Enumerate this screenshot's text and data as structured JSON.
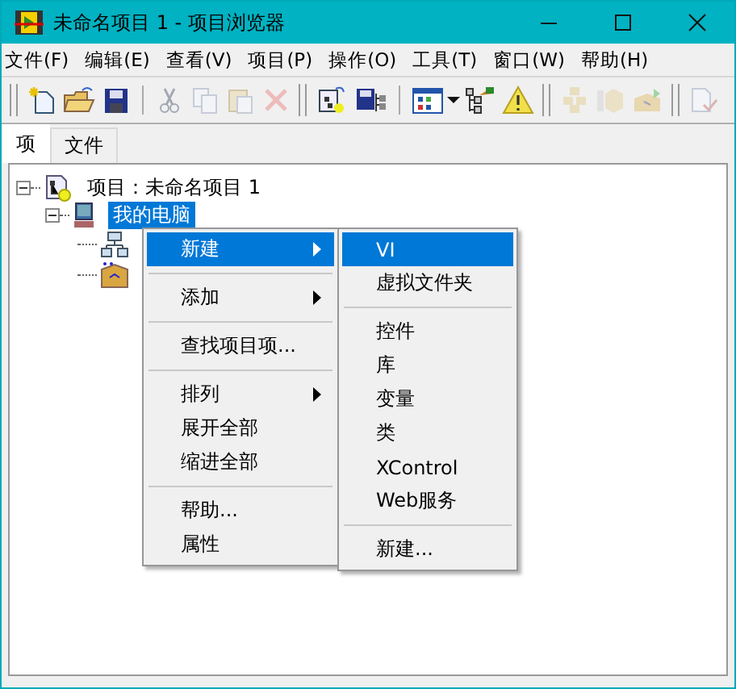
{
  "window": {
    "title": "未命名项目 1 - 项目浏览器"
  },
  "menu_bar": [
    "文件(F)",
    "编辑(E)",
    "查看(V)",
    "项目(P)",
    "操作(O)",
    "工具(T)",
    "窗口(W)",
    "帮助(H)"
  ],
  "toolbar": [
    {
      "kind": "grip"
    },
    {
      "kind": "new",
      "disabled": false
    },
    {
      "kind": "open",
      "disabled": false
    },
    {
      "kind": "save",
      "disabled": false
    },
    {
      "kind": "sep"
    },
    {
      "kind": "cut",
      "disabled": true
    },
    {
      "kind": "copy",
      "disabled": true
    },
    {
      "kind": "paste",
      "disabled": true
    },
    {
      "kind": "delete",
      "disabled": true
    },
    {
      "kind": "grip"
    },
    {
      "kind": "build",
      "disabled": false
    },
    {
      "kind": "saveall",
      "disabled": false
    },
    {
      "kind": "sep"
    },
    {
      "kind": "view",
      "disabled": false
    },
    {
      "kind": "dropdown",
      "disabled": false
    },
    {
      "kind": "tools",
      "disabled": false
    },
    {
      "kind": "warning",
      "disabled": false
    },
    {
      "kind": "grip"
    },
    {
      "kind": "cubes",
      "disabled": true
    },
    {
      "kind": "cube",
      "disabled": true
    },
    {
      "kind": "package",
      "disabled": true
    },
    {
      "kind": "grip"
    },
    {
      "kind": "doc",
      "disabled": true
    }
  ],
  "tabs": [
    {
      "label": "项",
      "selected": true
    },
    {
      "label": "文件",
      "selected": false
    }
  ],
  "tree": [
    {
      "label": "项目：未命名项目 1",
      "kind": "project",
      "expanded": true,
      "selected": false,
      "children": [
        {
          "label": "我的电脑",
          "kind": "computer",
          "expanded": true,
          "selected": true,
          "children": [
            {
              "kind": "network"
            },
            {
              "kind": "build-spec"
            }
          ]
        }
      ]
    }
  ],
  "context_menu": [
    {
      "label": "新建",
      "submenu": true,
      "selected": true
    },
    {
      "kind": "sep"
    },
    {
      "label": "添加",
      "submenu": true,
      "selected": false
    },
    {
      "kind": "sep"
    },
    {
      "label": "查找项目项...",
      "submenu": false,
      "selected": false
    },
    {
      "kind": "sep"
    },
    {
      "label": "排列",
      "submenu": true,
      "selected": false
    },
    {
      "label": "展开全部",
      "submenu": false,
      "selected": false
    },
    {
      "label": "缩进全部",
      "submenu": false,
      "selected": false
    },
    {
      "kind": "sep"
    },
    {
      "label": "帮助...",
      "submenu": false,
      "selected": false
    },
    {
      "label": "属性",
      "submenu": false,
      "selected": false
    }
  ],
  "submenu": [
    {
      "label": "VI",
      "selected": true
    },
    {
      "label": "虚拟文件夹",
      "selected": false
    },
    {
      "kind": "sep"
    },
    {
      "label": "控件",
      "selected": false
    },
    {
      "label": "库",
      "selected": false
    },
    {
      "label": "变量",
      "selected": false
    },
    {
      "label": "类",
      "selected": false
    },
    {
      "label": "XControl",
      "selected": false
    },
    {
      "label": "Web服务",
      "selected": false
    },
    {
      "kind": "sep"
    },
    {
      "label": "新建...",
      "selected": false
    }
  ]
}
